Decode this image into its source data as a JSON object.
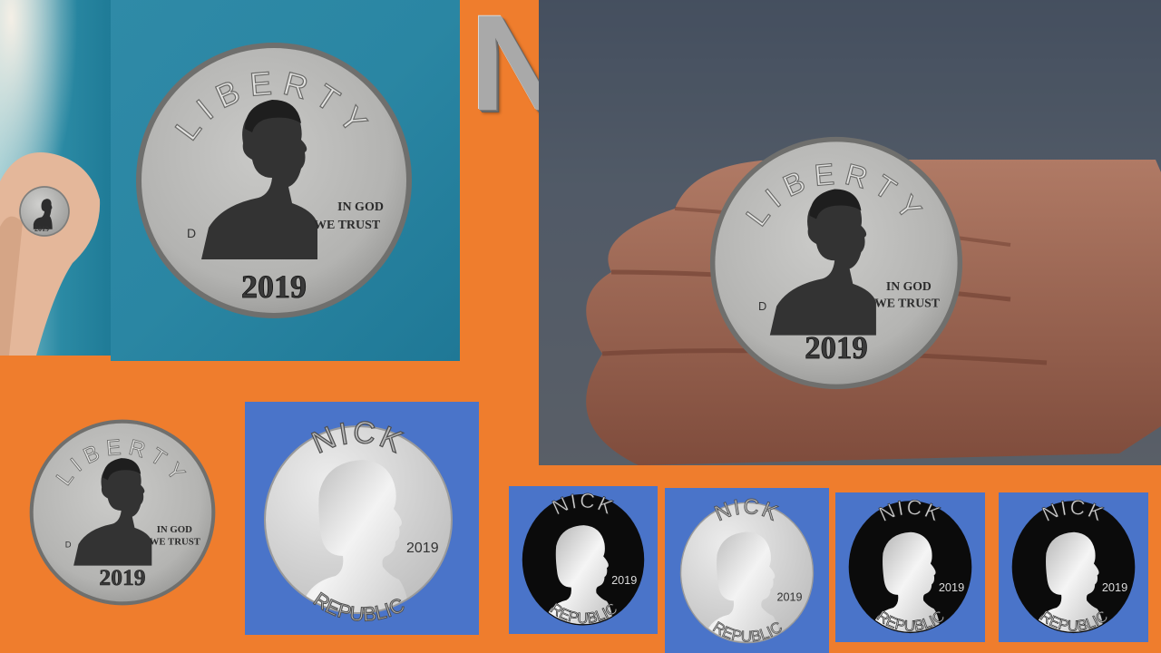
{
  "title": "NP",
  "coin": {
    "top_text": "LIBERTY",
    "motto_line1": "IN GOD",
    "motto_line2": "WE TRUST",
    "year": "2019",
    "mint_mark": "D"
  },
  "design": {
    "top_text": "NICK",
    "bottom_text": "REPUBLIC",
    "year": "2019"
  },
  "colors": {
    "background": "#ef7d2d",
    "tile_blue": "#4a74c9",
    "teal_wall": "#2f8aa7",
    "coin_silver": "#b9b9b7",
    "coin_black": "#0b0b0b"
  }
}
